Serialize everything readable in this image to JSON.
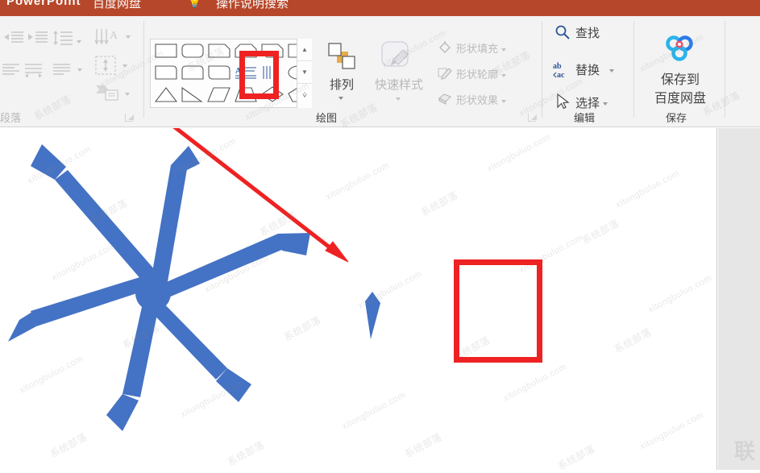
{
  "app": {
    "title_bar": {
      "app_name": "PowerPoint",
      "baidu_netdisk": "百度网盘",
      "tell_me": "操作说明搜索",
      "tell_me_icon": "lightbulb-icon",
      "bg_color": "#b7472a"
    }
  },
  "ribbon": {
    "groups": [
      {
        "id": "paragraph",
        "label": "段落",
        "dimmed": true
      },
      {
        "id": "drawing",
        "label": "绘图",
        "dimmed": false
      },
      {
        "id": "editing",
        "label": "编辑",
        "dimmed": false
      },
      {
        "id": "save",
        "label": "保存",
        "dimmed": false
      }
    ],
    "drawing": {
      "gallery": {
        "name": "shapes-gallery",
        "rows": [
          [
            "rectangle",
            "rounded-rectangle",
            "snip-single-corner-rectangle",
            "snip-same-side-corner-rectangle",
            "snip-diagonal-corner-rectangle",
            "snip-and-round-single-corner-rectangle"
          ],
          [
            "round-single-corner-rectangle",
            "round-same-side-corner-rectangle",
            "round-diagonal-corner-rectangle",
            "text-box",
            "vertical-text-box",
            "oval"
          ],
          [
            "isosceles-triangle",
            "right-triangle",
            "parallelogram",
            "trapezoid",
            "diamond",
            "pentagon"
          ]
        ],
        "selected_shape": "diamond",
        "scroll_up": "▲",
        "scroll_down": "▼",
        "more_shapes": "⩒"
      },
      "arrange": {
        "label": "排列",
        "icon": "arrange-icon",
        "has_dropdown": true
      },
      "quick_styles": {
        "label": "快速样式",
        "icon": "quick-styles-icon",
        "has_dropdown": true,
        "dimmed": true
      },
      "shape_fill": {
        "label": "形状填充",
        "icon": "paint-bucket-icon",
        "has_dropdown": true,
        "dimmed": true
      },
      "shape_outline": {
        "label": "形状轮廓",
        "icon": "pencil-outline-icon",
        "has_dropdown": true,
        "dimmed": true
      },
      "shape_effects": {
        "label": "形状效果",
        "icon": "shape-effects-icon",
        "has_dropdown": true,
        "dimmed": true
      }
    },
    "editing": {
      "find": {
        "label": "查找",
        "icon": "magnifier-icon"
      },
      "replace": {
        "label": "替换",
        "icon": "ab-ac-replace-icon",
        "has_dropdown": true
      },
      "select": {
        "label": "选择",
        "icon": "cursor-arrow-icon",
        "has_dropdown": true
      }
    },
    "save_group": {
      "button": {
        "label_line1": "保存到",
        "label_line2": "百度网盘",
        "icon": "baidu-netdisk-icon"
      }
    }
  },
  "canvas": {
    "name": "slide-canvas",
    "shapes": [
      {
        "name": "snowflake-shape",
        "type": "freeform-star",
        "arms": 6,
        "fill_color": "#4472c4"
      },
      {
        "name": "thin-diamond-shape",
        "type": "kite",
        "fill_color": "#4472c4"
      }
    ],
    "annotations": [
      {
        "name": "source-highlight-box",
        "type": "red-rectangle",
        "color": "#ee2222",
        "target": "diamond-shape-in-gallery"
      },
      {
        "name": "result-highlight-box",
        "type": "red-rectangle",
        "color": "#ee2222",
        "target": "thin-diamond-shape"
      },
      {
        "name": "pointer-arrow",
        "type": "red-arrow",
        "color": "#ee2222"
      }
    ]
  },
  "watermarks": {
    "text_latin": "xitongbuluo.com",
    "text_cn": "系统部落",
    "corner": "联"
  }
}
